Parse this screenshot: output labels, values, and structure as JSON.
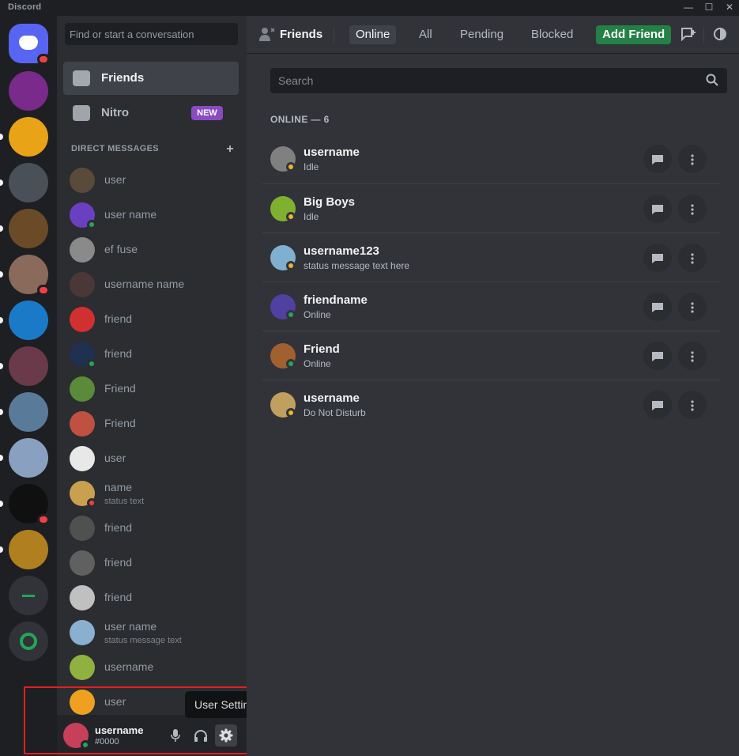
{
  "window": {
    "title": "Discord",
    "controls": [
      "—",
      "☐",
      "✕"
    ]
  },
  "guilds": [
    {
      "kind": "home",
      "color": "#5865f2",
      "badge": true
    },
    {
      "kind": "server",
      "color": "#7a2a8a"
    },
    {
      "kind": "server",
      "color": "#e8a317",
      "pill": true
    },
    {
      "kind": "server",
      "color": "#4a5058",
      "pill": true
    },
    {
      "kind": "server",
      "color": "#6b4a28",
      "pill": true
    },
    {
      "kind": "server",
      "color": "#8a6a5a",
      "pill": true,
      "badge": true
    },
    {
      "kind": "server",
      "color": "#1a7ac8",
      "pill": true
    },
    {
      "kind": "server",
      "color": "#6a3a4a",
      "pill": true
    },
    {
      "kind": "server",
      "color": "#5a7a9a",
      "pill": true
    },
    {
      "kind": "server",
      "color": "#8aa0c0",
      "pill": true
    },
    {
      "kind": "server",
      "color": "#101010",
      "pill": true,
      "badge": true
    },
    {
      "kind": "server",
      "color": "#b08020",
      "pill": true
    },
    {
      "kind": "add"
    },
    {
      "kind": "discover"
    }
  ],
  "sidebar": {
    "search_placeholder": "Find or start a conversation",
    "nav": [
      {
        "label": "Friends",
        "selected": true
      },
      {
        "label": "Nitro",
        "badge": "NEW"
      }
    ],
    "dm_header": "DIRECT MESSAGES",
    "dms": [
      {
        "name": "user",
        "avatar": "#5a4a3a",
        "status": null
      },
      {
        "name": "user name",
        "avatar": "#6a40c0",
        "status": "#23a55a"
      },
      {
        "name": "ef fuse",
        "avatar": "#8a8a8a",
        "status": null
      },
      {
        "name": "username name",
        "avatar": "#4a3838",
        "status": null
      },
      {
        "name": "friend",
        "avatar": "#d03030",
        "status": null
      },
      {
        "name": "friend",
        "avatar": "#203050",
        "status": "#23a55a"
      },
      {
        "name": "Friend",
        "avatar": "#5a8a3a",
        "status": null
      },
      {
        "name": "Friend",
        "avatar": "#c05040",
        "status": null
      },
      {
        "name": "user",
        "avatar": "#e8e8e8",
        "status": null
      },
      {
        "name": "name",
        "sub": "status text",
        "avatar": "#c8a050",
        "status": "#f23f43"
      },
      {
        "name": "friend",
        "avatar": "#505050",
        "status": null
      },
      {
        "name": "friend",
        "avatar": "#606060",
        "status": null
      },
      {
        "name": "friend",
        "avatar": "#c0c0c0",
        "status": null
      },
      {
        "name": "user name",
        "sub": "status message text",
        "avatar": "#8ab0d0",
        "status": null
      },
      {
        "name": "username",
        "avatar": "#90b040",
        "status": null
      },
      {
        "name": "user",
        "avatar": "#f0a020",
        "status": null
      }
    ]
  },
  "user": {
    "name": "username",
    "tag": "#0000",
    "tooltip": "User Settings"
  },
  "topbar": {
    "title": "Friends",
    "tabs": [
      {
        "label": "Online",
        "active": true
      },
      {
        "label": "All"
      },
      {
        "label": "Pending"
      },
      {
        "label": "Blocked"
      },
      {
        "label": "Add Friend",
        "add": true
      }
    ]
  },
  "friends": {
    "search_placeholder": "Search",
    "online_label": "ONLINE — 6",
    "list": [
      {
        "name": "username",
        "sub": "Idle",
        "avatar": "#808080",
        "status": "#f0b232"
      },
      {
        "name": "Big Boys",
        "sub": "Idle",
        "avatar": "#80b030",
        "status": "#f0b232"
      },
      {
        "name": "username123",
        "sub": "status message text here",
        "avatar": "#80b0d0",
        "status": "#f0b232"
      },
      {
        "name": "friendname",
        "sub": "Online",
        "avatar": "#5040a0",
        "status": "#23a55a"
      },
      {
        "name": "Friend",
        "sub": "Online",
        "avatar": "#a06030",
        "status": "#23a55a"
      },
      {
        "name": "username",
        "sub": "Do Not Disturb",
        "avatar": "#c0a060",
        "status": "#f0b232"
      }
    ]
  }
}
